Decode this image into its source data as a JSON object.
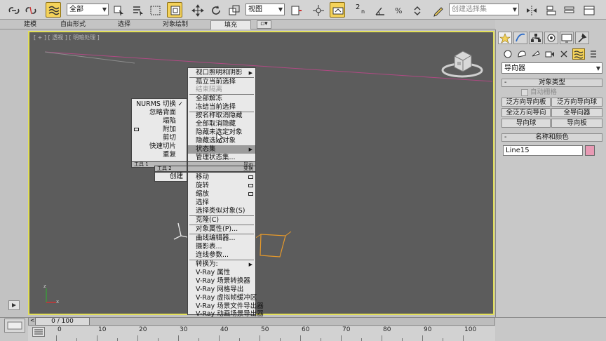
{
  "toolbar": {
    "selection_filter": "全部",
    "ref_coord": "视图",
    "named_selection_placeholder": "创建选择集",
    "snap_label": "2",
    "snap_sub": "n"
  },
  "ribbon": {
    "tabs": [
      "建模",
      "自由形式",
      "选择",
      "对象绘制",
      "填充"
    ],
    "active_tab": "填充"
  },
  "viewport": {
    "label": "[ + ] [ 透视 ] [ 明暗处理 ]",
    "border_color": "#e3e05a"
  },
  "quad_left": {
    "items": [
      "NURMS 切换",
      "忽略背面",
      "塌陷",
      "附加",
      "剪切",
      "快速切片",
      "重复"
    ],
    "checked_index": 0,
    "header_left": "工具 1",
    "header_right": "显示"
  },
  "quad_left_bottom": {
    "header": "工具 2",
    "items": [
      "创建"
    ]
  },
  "quad_display": {
    "items": [
      "视口照明和阴影",
      "孤立当前选择",
      "结束隔离",
      "全部解冻",
      "冻结当前选择",
      "按名称取消隐藏",
      "全部取消隐藏",
      "隐藏未选定对象",
      "隐藏选定对象",
      "状态集",
      "管理状态集..."
    ],
    "highlighted": "状态集"
  },
  "quad_transform": {
    "header": "变换",
    "items": [
      "移动",
      "旋转",
      "缩放",
      "选择",
      "选择类似对象(S)",
      "克隆(C)",
      "对象属性(P)...",
      "曲线编辑器...",
      "摄影表...",
      "连线参数...",
      "转换为:",
      "V-Ray 属性",
      "V-Ray 场景转换器",
      "V-Ray 网格导出",
      "V-Ray 虚拟帧缓冲区",
      "V-Ray 场景文件导出器",
      "V-Ray 动画场景导出器"
    ]
  },
  "command_panel": {
    "category": "导向器",
    "object_type": {
      "title": "对象类型",
      "autogrid": "自动栅格",
      "buttons": [
        "泛方向导向板",
        "泛方向导向球",
        "全泛方向导向",
        "全导向器",
        "导向球",
        "导向板"
      ]
    },
    "name_color": {
      "title": "名称和颜色",
      "name_value": "Line15",
      "color": "#e89ab4"
    }
  },
  "timeline": {
    "frame_display": "0 / 100",
    "ticks": [
      "0",
      "10",
      "20",
      "30",
      "40",
      "50",
      "60",
      "70",
      "80",
      "90",
      "100"
    ]
  },
  "colors": {
    "accent": "#f4d25a",
    "selection_outline": "#e3e05a",
    "spline_orange": "#e89a2a",
    "pink_line": "#b04a84"
  },
  "icons": [
    "link-icon",
    "unlink-icon",
    "bind-spacewarp-icon",
    "select-object-icon",
    "select-by-name-icon",
    "rect-region-icon",
    "window-crossing-icon",
    "move-icon",
    "rotate-icon",
    "scale-icon",
    "pivot-icon",
    "mirror-icon",
    "snap-icon",
    "angle-snap-icon",
    "percent-snap-icon",
    "spinner-snap-icon",
    "edit-named-selection-icon",
    "viewcube-icon"
  ]
}
